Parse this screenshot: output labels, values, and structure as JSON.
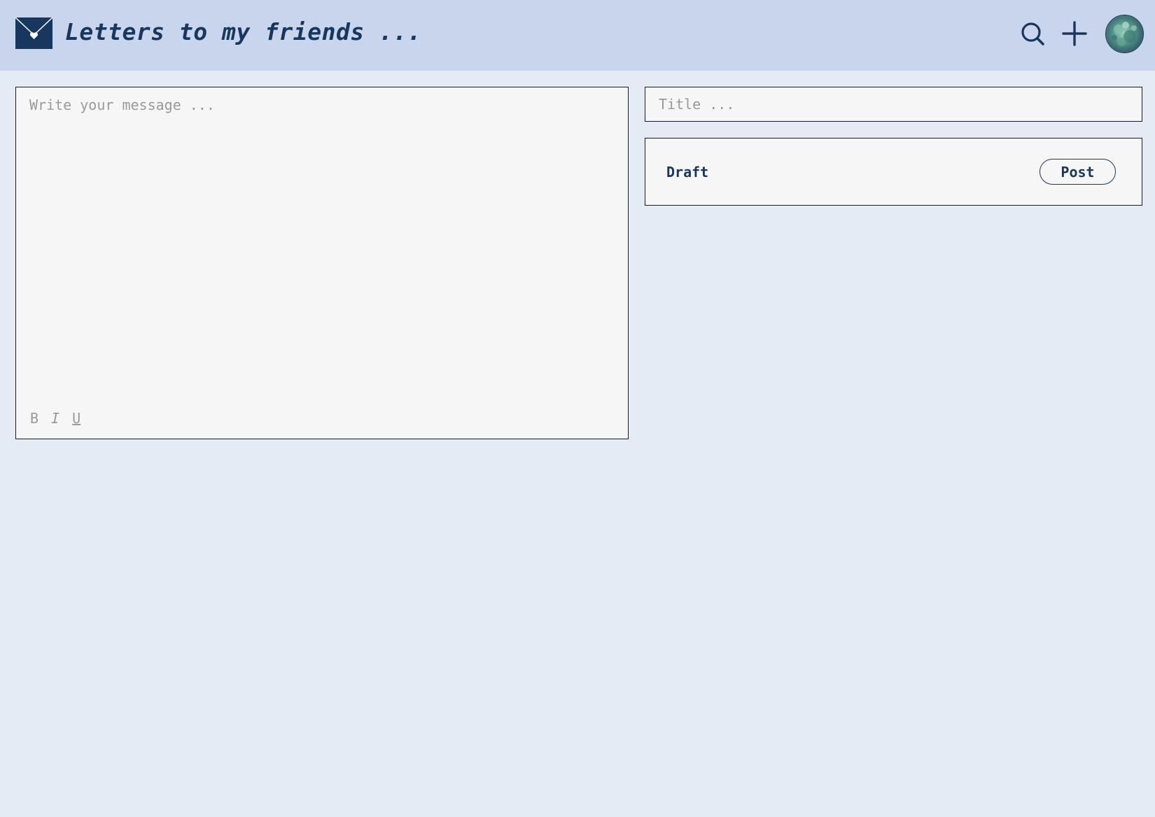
{
  "header": {
    "title": "Letters to my friends ...",
    "logo_icon": "envelope-heart-icon",
    "search_icon": "search-icon",
    "add_icon": "plus-icon",
    "avatar_icon": "user-avatar"
  },
  "editor": {
    "message_placeholder": "Write your message ...",
    "message_value": "",
    "format": {
      "bold_label": "B",
      "italic_label": "I",
      "underline_label": "U"
    }
  },
  "side": {
    "title_placeholder": "Title ...",
    "title_value": "",
    "draft_label": "Draft",
    "post_label": "Post"
  },
  "colors": {
    "header_bg": "#c8d5ec",
    "page_bg": "#e4ebf5",
    "accent": "#17375e",
    "panel_bg": "#f6f6f6",
    "placeholder": "#9a9a9a"
  }
}
